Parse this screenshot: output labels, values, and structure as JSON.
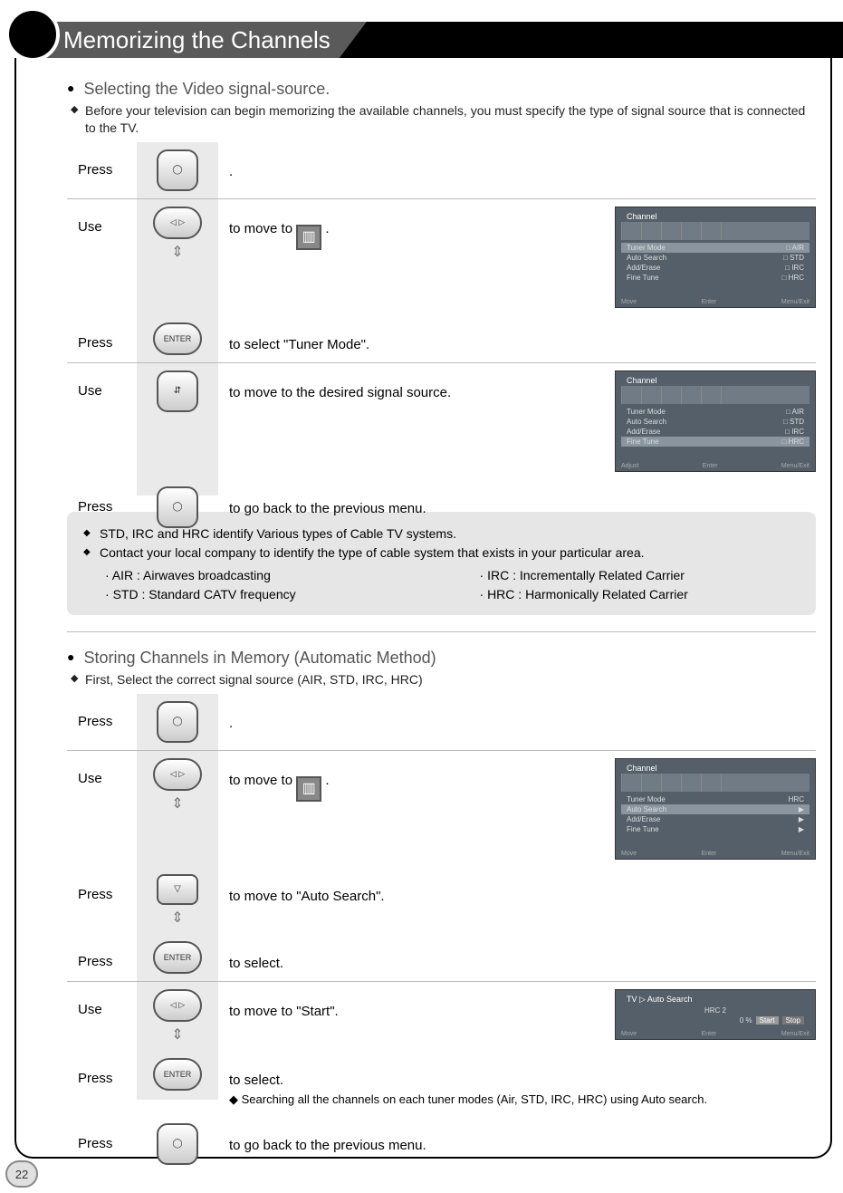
{
  "page_number": "22",
  "title": "Memorizing the Channels",
  "section1": {
    "heading": "Selecting the Video signal-source.",
    "intro": "Before your television can begin memorizing the available channels, you must specify the type of signal source that is connected to the TV.",
    "steps": [
      {
        "label": "Press",
        "icon": "menu-button",
        "text": "."
      },
      {
        "label": "Use",
        "icon": "arrow-cluster",
        "text_pre": "to move to ",
        "text_post": " ."
      },
      {
        "label": "Press",
        "icon": "enter-button",
        "text": "to select \"Tuner Mode\"."
      },
      {
        "label": "Use",
        "icon": "up-down-button",
        "text": "to move to the desired signal source."
      },
      {
        "label": "Press",
        "icon": "menu-button",
        "text": "to go back to the previous menu."
      }
    ],
    "osd1": {
      "title": "Channel",
      "items": [
        "Tuner Mode",
        "Auto Search",
        "Add/Erase",
        "Fine Tune"
      ],
      "opts": [
        "□ AIR",
        "□ STD",
        "□ IRC",
        "□ HRC"
      ],
      "foot": [
        "Move",
        "Enter",
        "Menu/Exit"
      ]
    },
    "osd2": {
      "title": "Channel",
      "items": [
        "Tuner Mode",
        "Auto Search",
        "Add/Erase",
        "Fine Tune"
      ],
      "opts": [
        "□ AIR",
        "□ STD",
        "□ IRC",
        "□ HRC"
      ],
      "foot": [
        "Adjust",
        "Enter",
        "Menu/Exit"
      ]
    }
  },
  "info": {
    "line1": "STD, IRC and HRC identify Various types of Cable TV systems.",
    "line2": "Contact your local company to identify the type of cable system that exists in your particular area.",
    "defs_left": [
      "AIR :  Airwaves broadcasting",
      "STD : Standard CATV frequency"
    ],
    "defs_right": [
      "IRC :  Incrementally Related Carrier",
      "HRC :  Harmonically Related Carrier"
    ]
  },
  "section2": {
    "heading": "Storing Channels in Memory (Automatic Method)",
    "intro": "First, Select the correct signal source (AIR, STD, IRC, HRC)",
    "steps": [
      {
        "label": "Press",
        "icon": "menu-button",
        "text": "."
      },
      {
        "label": "Use",
        "icon": "arrow-cluster",
        "text_pre": "to move to ",
        "text_post": " ."
      },
      {
        "label": "Press",
        "icon": "down-button",
        "text": "to move to \"Auto Search\"."
      },
      {
        "label": "Press",
        "icon": "enter-button",
        "text": "to select."
      },
      {
        "label": "Use",
        "icon": "arrow-cluster",
        "text": "to move to \"Start\"."
      },
      {
        "label": "Press",
        "icon": "enter-button",
        "text": "to select.",
        "sub": "Searching all the channels on each tuner modes (Air, STD, IRC, HRC) using Auto search."
      },
      {
        "label": "Press",
        "icon": "menu-button",
        "text": "to go back to the previous menu."
      }
    ],
    "osd3": {
      "title": "Channel",
      "items": [
        "Tuner Mode",
        "Auto Search",
        "Add/Erase",
        "Fine Tune"
      ],
      "vals": [
        "HRC",
        "▶",
        "▶",
        "▶"
      ],
      "foot": [
        "Move",
        "Enter",
        "Menu/Exit"
      ]
    },
    "osd4": {
      "title": "TV ▷ Auto Search",
      "line": "HRC   2",
      "pct": "0 %",
      "btns": [
        "Start",
        "Stop"
      ],
      "foot": [
        "Move",
        "Enter",
        "Menu/Exit"
      ]
    }
  }
}
